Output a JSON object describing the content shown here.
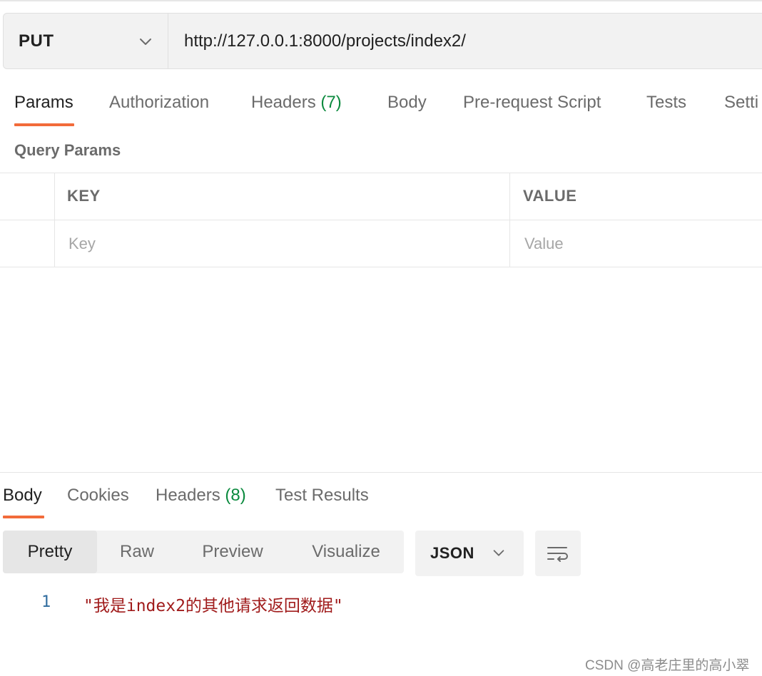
{
  "request": {
    "method": "PUT",
    "url": "http://127.0.0.1:8000/projects/index2/"
  },
  "request_tabs": [
    {
      "label": "Params",
      "count": ""
    },
    {
      "label": "Authorization",
      "count": ""
    },
    {
      "label": "Headers",
      "count": "(7)"
    },
    {
      "label": "Body",
      "count": ""
    },
    {
      "label": "Pre-request Script",
      "count": ""
    },
    {
      "label": "Tests",
      "count": ""
    },
    {
      "label": "Setti",
      "count": ""
    }
  ],
  "active_request_tab": "Params",
  "query_params": {
    "title": "Query Params",
    "headers": [
      "KEY",
      "VALUE"
    ],
    "key_placeholder": "Key",
    "value_placeholder": "Value"
  },
  "response_tabs": [
    {
      "label": "Body",
      "count": ""
    },
    {
      "label": "Cookies",
      "count": ""
    },
    {
      "label": "Headers",
      "count": "(8)"
    },
    {
      "label": "Test Results",
      "count": ""
    }
  ],
  "active_response_tab": "Body",
  "view_modes": [
    "Pretty",
    "Raw",
    "Preview",
    "Visualize"
  ],
  "active_view_mode": "Pretty",
  "format": "JSON",
  "response_body": [
    {
      "line": "1",
      "text": "\"我是index2的其他请求返回数据\""
    }
  ],
  "watermark": "CSDN @高老庄里的高小翠",
  "colors": {
    "accent": "#f26b3a",
    "count_green": "#0b8a3e",
    "string_red": "#a01b1b",
    "line_number_blue": "#2f6c9e"
  },
  "icons": [
    "chevron-down-icon",
    "wrap-lines-icon"
  ]
}
